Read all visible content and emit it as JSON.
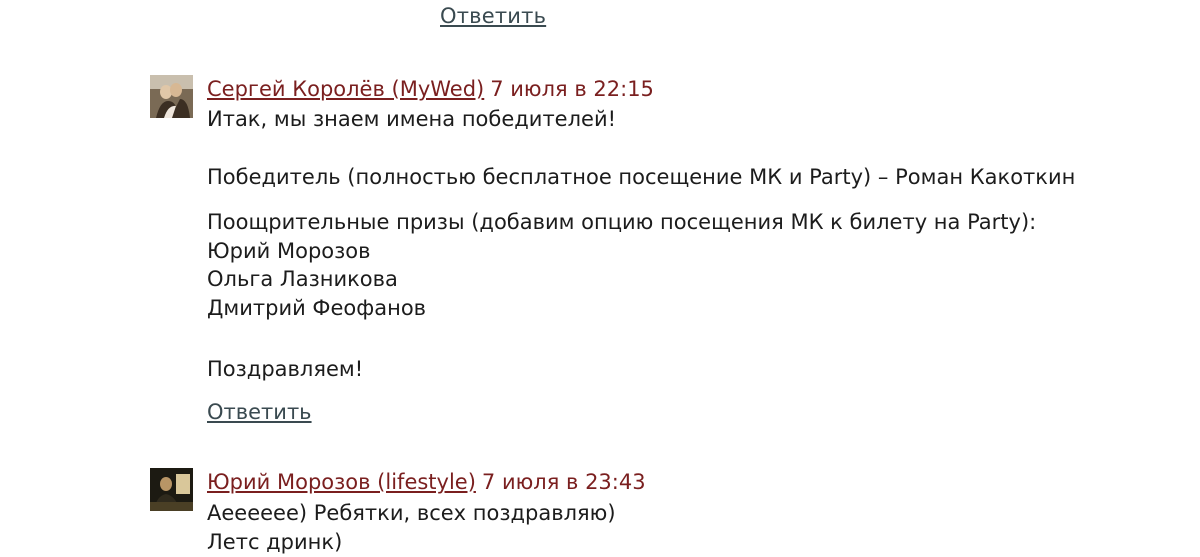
{
  "top_reply_label": "Ответить",
  "comments": [
    {
      "author": "Сергей Королёв (MyWed)",
      "time": "7 июля в 22:15",
      "lines": [
        "Итак, мы знаем имена победителей!",
        "Победитель (полностью бесплатное посещение МК и Party) – Роман Какоткин",
        "Поощрительные призы (добавим опцию посещения МК к билету на Party):",
        "Юрий Морозов",
        "Ольга Лазникова",
        "Дмитрий Феофанов",
        "Поздравляем!"
      ],
      "reply_label": "Ответить"
    },
    {
      "author": "Юрий Морозов (lifestyle)",
      "time": "7 июля в 23:43",
      "lines": [
        "Аееееее) Ребятки, всех поздравляю)",
        "Летс дринк)"
      ]
    }
  ],
  "colors": {
    "author_link": "#7a1f1f",
    "reply_link": "#3a4a50",
    "text": "#1c1c1c"
  }
}
